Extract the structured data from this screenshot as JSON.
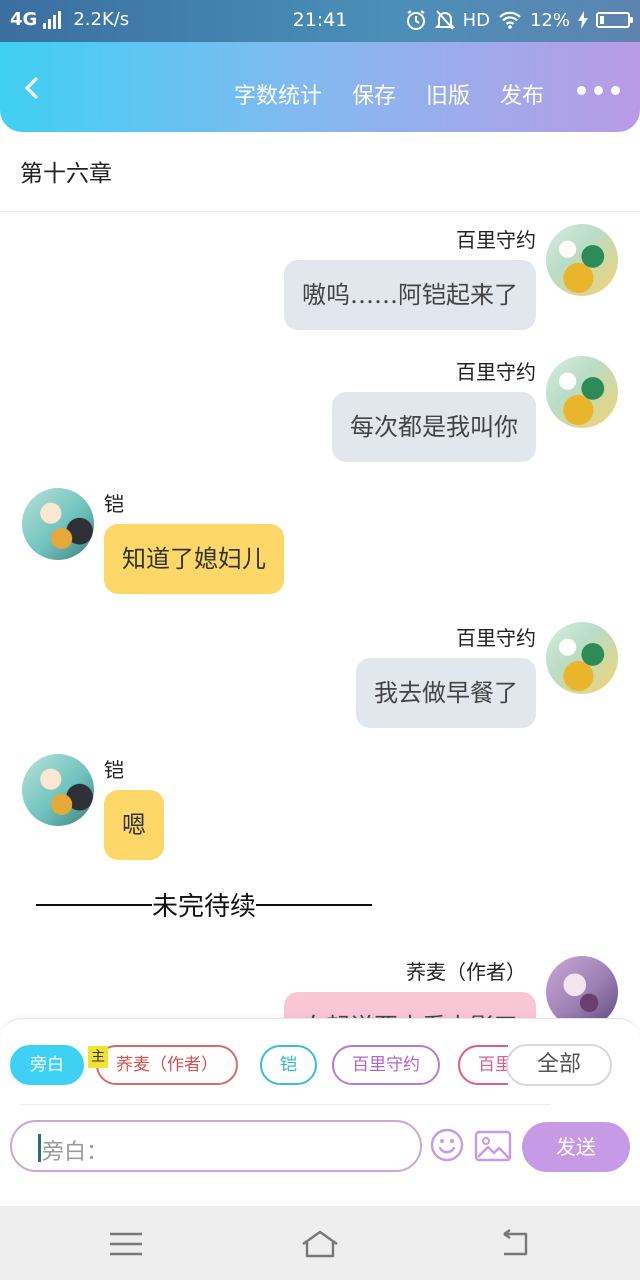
{
  "status_bar": {
    "network": "4G",
    "speed": "2.2K/s",
    "time": "21:41",
    "hd": "HD",
    "battery": "12%"
  },
  "header": {
    "actions": [
      "字数统计",
      "保存",
      "旧版",
      "发布"
    ],
    "back_icon": "chevron-left-icon",
    "more_icon": "more-dots-icon"
  },
  "chapter_title": "第十六章",
  "messages": [
    {
      "speaker": "百里守约",
      "text": "嗷呜……阿铠起来了",
      "side": "right"
    },
    {
      "speaker": "百里守约",
      "text": "每次都是我叫你",
      "side": "right"
    },
    {
      "speaker": "铠",
      "text": "知道了媳妇儿",
      "side": "left"
    },
    {
      "speaker": "百里守约",
      "text": "我去做早餐了",
      "side": "right"
    },
    {
      "speaker": "铠",
      "text": "嗯",
      "side": "left"
    },
    {
      "speaker": "荞麦（作者）",
      "text": "白起说要去看电影了",
      "side": "right"
    }
  ],
  "to_be_continued": "未完待续",
  "roles": {
    "chips": [
      "旁白",
      "荞麦（作者）",
      "铠",
      "百里守约",
      "百里守约"
    ],
    "main_tag": "主",
    "all_button": "全部"
  },
  "composer": {
    "placeholder": "旁白：",
    "send_label": "发送"
  },
  "colors": {
    "header_gradient_start": "#3fd0f2",
    "header_gradient_end": "#b99be6",
    "bubble_gray": "#e2e7ee",
    "bubble_yellow": "#fdd868",
    "bubble_pink": "#f9c6d6",
    "send_button": "#c79ae6"
  }
}
